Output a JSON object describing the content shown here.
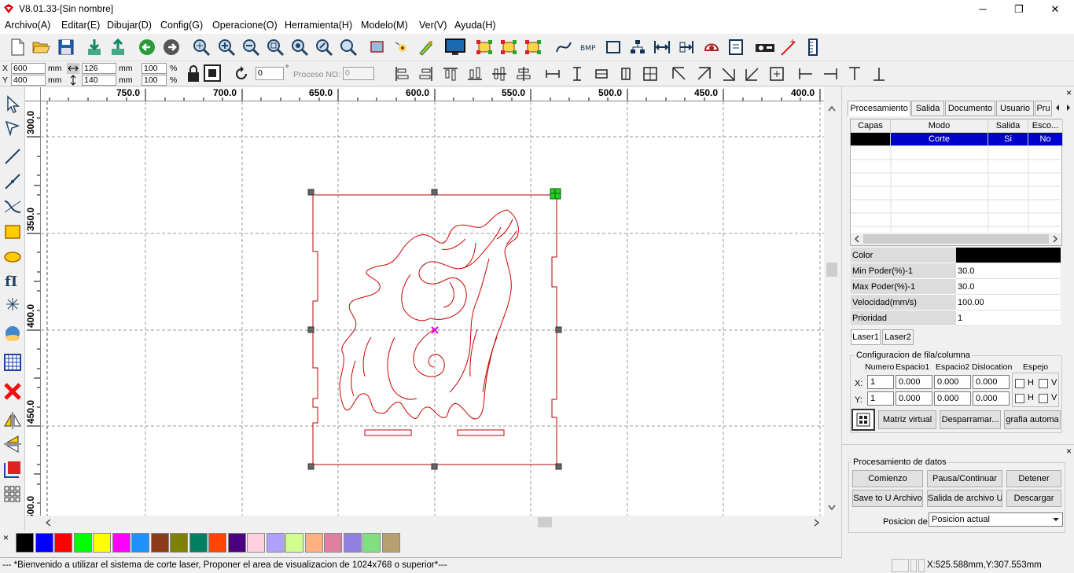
{
  "window": {
    "title": "V8.01.33-[Sin nombre]",
    "minimize": "─",
    "maximize": "❐",
    "close": "✕"
  },
  "menu": [
    "Archivo(A)",
    "Editar(E)",
    "Dibujar(D)",
    "Config(G)",
    "Operacione(O)",
    "Herramienta(H)",
    "Modelo(M)",
    "Ver(V)",
    "Ayuda(H)"
  ],
  "toolbar2": {
    "x_label": "X",
    "y_label": "Y",
    "x_value": "600",
    "y_value": "400",
    "unit": "mm",
    "width_value": "126",
    "height_value": "140",
    "scale_x": "100",
    "scale_y": "100",
    "percent": "%",
    "rotation_value": "0",
    "degree": "°",
    "proceso_label": "Proceso NO:",
    "proceso_value": "0"
  },
  "ruler": {
    "top_labels": [
      "750.0",
      "700.0",
      "650.0",
      "600.0",
      "550.0",
      "500.0",
      "450.0",
      "400.0"
    ],
    "left_labels": [
      "300.0",
      "350.0",
      "400.0",
      "450.0",
      "500.0"
    ]
  },
  "panel": {
    "close": "×",
    "tabs": [
      "Procesamiento",
      "Salida",
      "Documento",
      "Usuario",
      "Pru"
    ],
    "layer_headers": [
      "Capas",
      "Modo",
      "Salida",
      "Esco..."
    ],
    "layer_row": {
      "mode": "Corte",
      "output": "Si",
      "choice": "No",
      "color": "#000000"
    },
    "props": [
      {
        "label": "Color",
        "value": ""
      },
      {
        "label": "Min Poder(%)-1",
        "value": "30.0"
      },
      {
        "label": "Max Poder(%)-1",
        "value": "30.0"
      },
      {
        "label": "Velocidad(mm/s)",
        "value": "100.00"
      },
      {
        "label": "Prioridad",
        "value": "1"
      }
    ],
    "laser_tabs": [
      "Laser1",
      "Laser2"
    ],
    "array_group": "Configuracion de fila/columna",
    "array_headers": [
      "Numero",
      "Espacio1",
      "Espacio2",
      "Dislocation",
      "Espejo"
    ],
    "row_x": {
      "label": "X:",
      "num": "1",
      "e1": "0.000",
      "e2": "0.000",
      "disl": "0.000",
      "h": "H",
      "v": "V"
    },
    "row_y": {
      "label": "Y:",
      "num": "1",
      "e1": "0.000",
      "e2": "0.000",
      "disl": "0.000",
      "h": "H",
      "v": "V"
    },
    "btn_matriz": "Matriz virtual",
    "btn_desparramar": "Desparramar...",
    "btn_grafia": "grafia automa",
    "data_group": "Procesamiento de datos",
    "btn_comienzo": "Comienzo",
    "btn_pausa": "Pausa/Continuar",
    "btn_detener": "Detener",
    "btn_save_u": "Save to U Archivo",
    "btn_salida_u": "Salida de archivo U",
    "btn_descargar": "Descargar",
    "posicion_label": "Posicion de",
    "posicion_value": "Posicion actual"
  },
  "palette": [
    "#000000",
    "#0000ff",
    "#ff0000",
    "#00ff00",
    "#ffff00",
    "#ff00ff",
    "#1e90ff",
    "#8b3a1a",
    "#808000",
    "#008060",
    "#ff4500",
    "#4b0082",
    "#ffd0e0",
    "#b0a0ff",
    "#d0ff90",
    "#ffb080",
    "#e080a0",
    "#9080e0",
    "#80e080",
    "#b8a070"
  ],
  "palette_close": "×",
  "status": {
    "message": "--- *Bienvenido a utilizar el sistema de corte laser, Proponer el area de visualizacion de 1024x768 o superior*---",
    "coords": "X:525.588mm,Y:307.553mm"
  }
}
